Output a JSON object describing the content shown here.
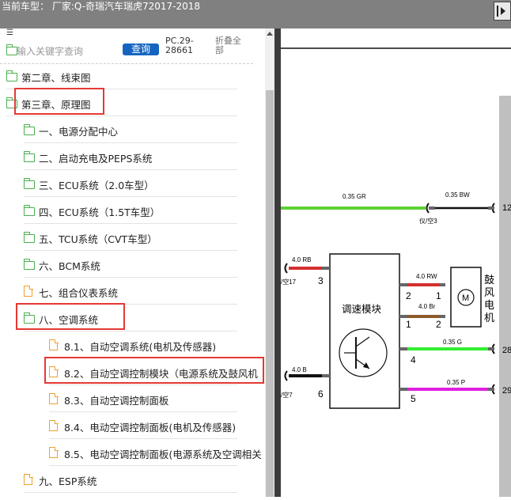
{
  "header": {
    "title": "当前车型：  厂家:Q-奇瑞汽车瑞虎72017-2018"
  },
  "search": {
    "placeholder": "输入关键字查询",
    "button": "查询",
    "pc_code": "PC.29-28661",
    "collapse": "折叠全部"
  },
  "tree": [
    {
      "label": "第二章、线束图",
      "icon": "folder-icon",
      "level": 0
    },
    {
      "label": "第三章、原理图",
      "icon": "folder-open-icon",
      "level": 0,
      "highlighted": true
    },
    {
      "label": "一、电源分配中心",
      "icon": "folder-icon",
      "level": 1
    },
    {
      "label": "二、启动充电及PEPS系统",
      "icon": "folder-icon",
      "level": 1
    },
    {
      "label": "三、ECU系统（2.0车型）",
      "icon": "folder-icon",
      "level": 1
    },
    {
      "label": "四、ECU系统（1.5T车型）",
      "icon": "folder-icon",
      "level": 1
    },
    {
      "label": "五、TCU系统（CVT车型）",
      "icon": "folder-icon",
      "level": 1
    },
    {
      "label": "六、BCM系统",
      "icon": "folder-icon",
      "level": 1
    },
    {
      "label": "七、组合仪表系统",
      "icon": "file-icon",
      "level": 1
    },
    {
      "label": "八、空调系统",
      "icon": "folder-open-icon",
      "level": 1,
      "highlighted": true
    },
    {
      "label": "8.1、自动空调系统(电机及传感器)",
      "icon": "file-icon",
      "level": 2
    },
    {
      "label": "8.2、自动空调控制模块（电源系统及鼓风机",
      "icon": "file-icon",
      "level": 2,
      "highlighted": true
    },
    {
      "label": "8.3、自动空调控制面板",
      "icon": "file-icon",
      "level": 2
    },
    {
      "label": "8.4、电动空调控制面板(电机及传感器)",
      "icon": "file-icon",
      "level": 2
    },
    {
      "label": "8.5、电动空调控制面板(电源系统及空调相关",
      "icon": "file-icon",
      "level": 2
    },
    {
      "label": "九、ESP系统",
      "icon": "file-icon",
      "level": 1
    }
  ],
  "diagram": {
    "wire_top_left": "0.35 GR",
    "wire_top_right": "0.35 BW",
    "conn_top": "仪/空3",
    "pin_top_right": "12",
    "wire_rb": "4.0 RB",
    "conn_left_top": "/空17",
    "pin_3": "3",
    "module_label": "调速模块",
    "wire_rw": "4.0 RW",
    "pin_2a": "2",
    "pin_1a": "1",
    "wire_br": "4.0 Br",
    "pin_1b": "1",
    "pin_2b": "2",
    "motor_label": "鼓风电机",
    "motor_symbol": "M",
    "wire_g": "0.35 G",
    "pin_4": "4",
    "pin_right_mid": "28",
    "wire_b": "4.0 B",
    "conn_left_bottom": "/空7",
    "pin_6": "6",
    "wire_p": "0.35 P",
    "pin_5": "5",
    "pin_right_bottom": "29",
    "colors": {
      "green": "#5dd233",
      "red": "#d32f2f",
      "brown": "#8d5a2b",
      "bright_green": "#33ee33",
      "magenta": "#e020e0",
      "black": "#111111"
    }
  }
}
